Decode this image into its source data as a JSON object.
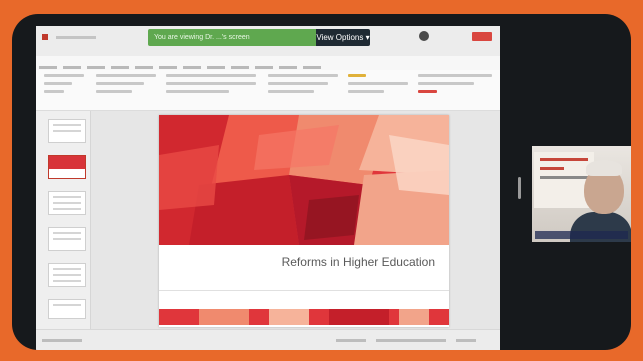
{
  "meeting": {
    "sharing_banner": "You are viewing Dr. ...'s screen",
    "view_options_label": "View Options",
    "view_options_arrow": "▾"
  },
  "presentation": {
    "slide_title": "Reforms in Higher Education",
    "thumbnail_count": 6,
    "selected_thumbnail": 1
  },
  "colors": {
    "frame_outer": "#e8692a",
    "banner_green": "#5fa84f",
    "slide_accent": "#d8343a"
  },
  "icons": {
    "participant_avatar": "avatar-icon",
    "share_button": "share-icon"
  }
}
